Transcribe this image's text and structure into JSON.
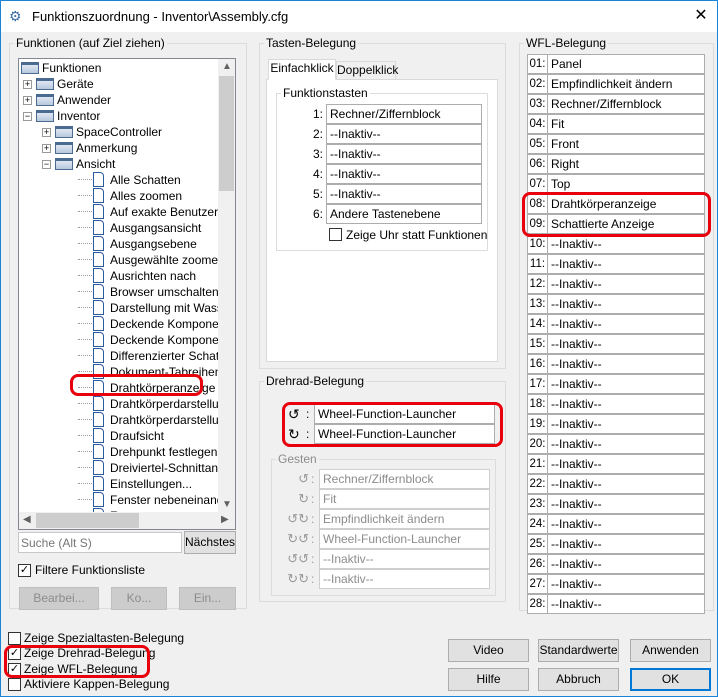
{
  "window": {
    "title": "Funktionszuordnung - Inventor\\Assembly.cfg",
    "close": "✕"
  },
  "functions": {
    "group_label": "Funktionen (auf Ziel ziehen)",
    "tree": [
      {
        "label": "Funktionen",
        "level": 0,
        "type": "folder"
      },
      {
        "label": "Geräte",
        "level": 1,
        "type": "folder",
        "toggle": "+"
      },
      {
        "label": "Anwender",
        "level": 1,
        "type": "folder",
        "toggle": "+"
      },
      {
        "label": "Inventor",
        "level": 1,
        "type": "folder",
        "toggle": "−"
      },
      {
        "label": "SpaceController",
        "level": 2,
        "type": "folder",
        "toggle": "+"
      },
      {
        "label": "Anmerkung",
        "level": 2,
        "type": "folder",
        "toggle": "+"
      },
      {
        "label": "Ansicht",
        "level": 2,
        "type": "folder",
        "toggle": "−"
      },
      {
        "label": "Alle Schatten",
        "level": 3,
        "type": "doc"
      },
      {
        "label": "Alles zoomen",
        "level": 3,
        "type": "doc"
      },
      {
        "label": "Auf exakte Benutzeroberfläche",
        "level": 3,
        "type": "doc"
      },
      {
        "label": "Ausgangsansicht",
        "level": 3,
        "type": "doc"
      },
      {
        "label": "Ausgangsebene",
        "level": 3,
        "type": "doc"
      },
      {
        "label": "Ausgewählte zoomen",
        "level": 3,
        "type": "doc"
      },
      {
        "label": "Ausrichten nach",
        "level": 3,
        "type": "doc"
      },
      {
        "label": "Browser umschalten",
        "level": 3,
        "type": "doc"
      },
      {
        "label": "Darstellung mit Wasserfarben",
        "level": 3,
        "type": "doc"
      },
      {
        "label": "Deckende Komponenten A",
        "level": 3,
        "type": "doc"
      },
      {
        "label": "Deckende Komponenten B",
        "level": 3,
        "type": "doc"
      },
      {
        "label": "Differenzierter Schatten",
        "level": 3,
        "type": "doc"
      },
      {
        "label": "Dokument-Tabreihenfolge",
        "level": 3,
        "type": "doc"
      },
      {
        "label": "Drahtkörperanzeige",
        "level": 3,
        "type": "doc",
        "highlight": true
      },
      {
        "label": "Drahtkörperdarstellung mit",
        "level": 3,
        "type": "doc"
      },
      {
        "label": "Drahtkörperdarstellung nur",
        "level": 3,
        "type": "doc"
      },
      {
        "label": "Draufsicht",
        "level": 3,
        "type": "doc"
      },
      {
        "label": "Drehpunkt festlegen",
        "level": 3,
        "type": "doc"
      },
      {
        "label": "Dreiviertel-Schnittansicht",
        "level": 3,
        "type": "doc"
      },
      {
        "label": "Einstellungen...",
        "level": 3,
        "type": "doc"
      },
      {
        "label": "Fenster nebeneinander",
        "level": 3,
        "type": "doc"
      },
      {
        "label": "Fenster",
        "level": 3,
        "type": "doc"
      }
    ],
    "search_placeholder": "Suche (Alt S)",
    "next_button": "Nächstes",
    "filter_label": "Filtere Funktionsliste",
    "filter_checked": true,
    "buttons": [
      "Bearbei...",
      "Ko...",
      "Ein..."
    ]
  },
  "bottom_checks": [
    {
      "label": "Zeige Spezialtasten-Belegung",
      "checked": false
    },
    {
      "label": "Zeige Drehrad-Belegung",
      "checked": true
    },
    {
      "label": "Zeige WFL-Belegung",
      "checked": true
    },
    {
      "label": "Aktiviere Kappen-Belegung",
      "checked": false
    }
  ],
  "keys": {
    "group_label": "Tasten-Belegung",
    "tabs": [
      "Einfachklick",
      "Doppelklick"
    ],
    "active_tab": 0,
    "subgroup_label": "Funktionstasten",
    "rows": [
      {
        "num": "1:",
        "value": "Rechner/Ziffernblock"
      },
      {
        "num": "2:",
        "value": "--Inaktiv--"
      },
      {
        "num": "3:",
        "value": "--Inaktiv--"
      },
      {
        "num": "4:",
        "value": "--Inaktiv--"
      },
      {
        "num": "5:",
        "value": "--Inaktiv--"
      },
      {
        "num": "6:",
        "value": "Andere Tastenebene"
      }
    ],
    "clock_label": "Zeige Uhr statt Funktionen",
    "clock_checked": false
  },
  "wheel": {
    "group_label": "Drehrad-Belegung",
    "rows": [
      {
        "icon": "↺",
        "value": "Wheel-Function-Launcher"
      },
      {
        "icon": "↻",
        "value": "Wheel-Function-Launcher"
      }
    ],
    "gestures_label": "Gesten",
    "gestures": [
      {
        "icon": "↺",
        "value": "Rechner/Ziffernblock"
      },
      {
        "icon": "↻",
        "value": "Fit"
      },
      {
        "icon": "↺↻",
        "value": "Empfindlichkeit ändern"
      },
      {
        "icon": "↻↺",
        "value": "Wheel-Function-Launcher"
      },
      {
        "icon": "↺↺",
        "value": "--Inaktiv--"
      },
      {
        "icon": "↻↻",
        "value": "--Inaktiv--"
      }
    ]
  },
  "wfl": {
    "group_label": "WFL-Belegung",
    "rows": [
      {
        "num": "01:",
        "value": "Panel"
      },
      {
        "num": "02:",
        "value": "Empfindlichkeit ändern"
      },
      {
        "num": "03:",
        "value": "Rechner/Ziffernblock"
      },
      {
        "num": "04:",
        "value": "Fit"
      },
      {
        "num": "05:",
        "value": "Front"
      },
      {
        "num": "06:",
        "value": "Right"
      },
      {
        "num": "07:",
        "value": "Top"
      },
      {
        "num": "08:",
        "value": "Drahtkörperanzeige"
      },
      {
        "num": "09:",
        "value": "Schattierte Anzeige"
      },
      {
        "num": "10:",
        "value": "--Inaktiv--"
      },
      {
        "num": "11:",
        "value": "--Inaktiv--"
      },
      {
        "num": "12:",
        "value": "--Inaktiv--"
      },
      {
        "num": "13:",
        "value": "--Inaktiv--"
      },
      {
        "num": "14:",
        "value": "--Inaktiv--"
      },
      {
        "num": "15:",
        "value": "--Inaktiv--"
      },
      {
        "num": "16:",
        "value": "--Inaktiv--"
      },
      {
        "num": "17:",
        "value": "--Inaktiv--"
      },
      {
        "num": "18:",
        "value": "--Inaktiv--"
      },
      {
        "num": "19:",
        "value": "--Inaktiv--"
      },
      {
        "num": "20:",
        "value": "--Inaktiv--"
      },
      {
        "num": "21:",
        "value": "--Inaktiv--"
      },
      {
        "num": "22:",
        "value": "--Inaktiv--"
      },
      {
        "num": "23:",
        "value": "--Inaktiv--"
      },
      {
        "num": "24:",
        "value": "--Inaktiv--"
      },
      {
        "num": "25:",
        "value": "--Inaktiv--"
      },
      {
        "num": "26:",
        "value": "--Inaktiv--"
      },
      {
        "num": "27:",
        "value": "--Inaktiv--"
      },
      {
        "num": "28:",
        "value": "--Inaktiv--"
      }
    ]
  },
  "actions": {
    "video": "Video",
    "defaults": "Standardwerte",
    "apply": "Anwenden",
    "help": "Hilfe",
    "cancel": "Abbruch",
    "ok": "OK"
  },
  "colors": {
    "highlight": "#e8000d",
    "title_border": "#1883d7"
  }
}
